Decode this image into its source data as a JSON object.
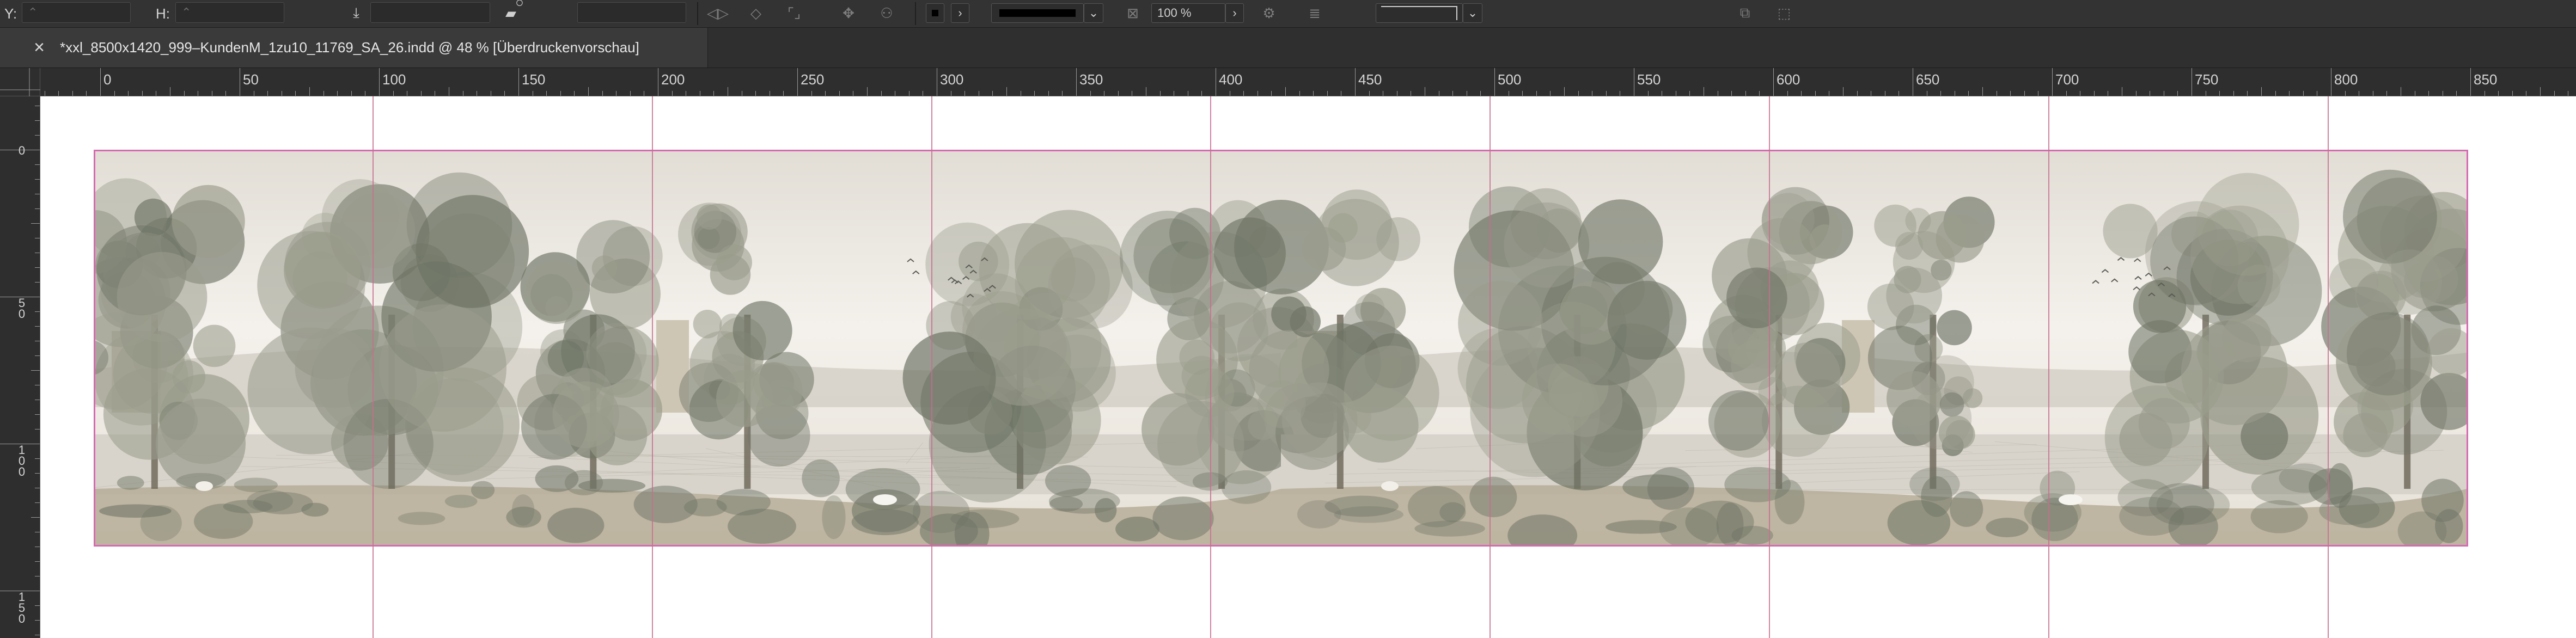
{
  "control_bar": {
    "y_label": "Y:",
    "h_label": "H:",
    "zoom_value": "100 %",
    "stroke_color": "#000000"
  },
  "tab": {
    "close_glyph": "×",
    "title": "*xxl_8500x1420_999–KundenM_1zu10_11769_SA_26.indd @ 48 % [Überdruckenvorschau]"
  },
  "ruler_h": {
    "labels": [
      "0",
      "50",
      "100",
      "150",
      "200",
      "250",
      "300",
      "350",
      "400",
      "450",
      "500",
      "550",
      "600",
      "650",
      "700",
      "750",
      "800",
      "850"
    ]
  },
  "ruler_v": {
    "labels": [
      [
        "0"
      ],
      [
        "5",
        "0"
      ],
      [
        "1",
        "0",
        "0"
      ],
      [
        "1",
        "5",
        "0"
      ]
    ]
  },
  "colors": {
    "frame": "#d56ab0",
    "guide": "#c66e8e",
    "sky": "#f4f1ec",
    "foliage_dark": "#6f7566",
    "foliage_mid": "#9a9c8c",
    "water": "#d8d4cc",
    "ground": "#b6ad98"
  },
  "artwork": {
    "panels": 8,
    "repeat_copies": 2
  }
}
